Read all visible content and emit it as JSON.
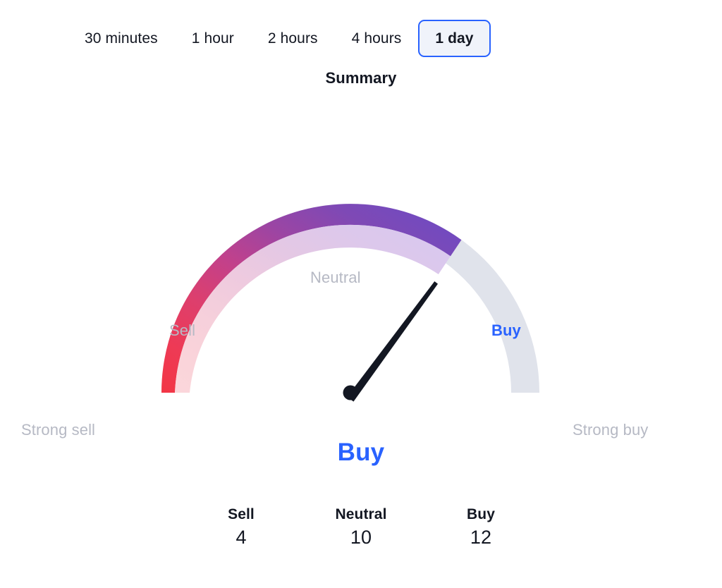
{
  "timeframes": {
    "options": [
      {
        "label": "30 minutes",
        "selected": false
      },
      {
        "label": "1 hour",
        "selected": false
      },
      {
        "label": "2 hours",
        "selected": false
      },
      {
        "label": "4 hours",
        "selected": false
      },
      {
        "label": "1 day",
        "selected": true
      }
    ],
    "selected_label": "1 day"
  },
  "summary": {
    "title": "Summary",
    "verdict": "Buy"
  },
  "gauge": {
    "zone_labels": {
      "strong_sell": "Strong sell",
      "sell": "Sell",
      "neutral": "Neutral",
      "buy": "Buy",
      "strong_buy": "Strong buy"
    },
    "active_zone": "buy"
  },
  "counts": {
    "items": [
      {
        "label": "Sell",
        "value": "4"
      },
      {
        "label": "Neutral",
        "value": "10"
      },
      {
        "label": "Buy",
        "value": "12"
      }
    ]
  },
  "colors": {
    "accent_blue": "#2962ff",
    "text_dark": "#131722",
    "text_muted": "#b6b9c4",
    "tab_selected_bg": "#f0f3fa",
    "arc_track_gray": "#e0e3eb",
    "arc_red": "#f0384f",
    "arc_crimson": "#d8406f",
    "arc_magenta": "#b8408f",
    "arc_purple_mid": "#8d46a7",
    "arc_purple": "#6b4bc4",
    "needle": "#131722"
  },
  "chart_data": {
    "type": "gauge",
    "title": "Summary",
    "zones": [
      {
        "name": "Strong sell",
        "start_deg": -90,
        "end_deg": -54
      },
      {
        "name": "Sell",
        "start_deg": -54,
        "end_deg": -18
      },
      {
        "name": "Neutral",
        "start_deg": -18,
        "end_deg": 18
      },
      {
        "name": "Buy",
        "start_deg": 18,
        "end_deg": 54
      },
      {
        "name": "Strong buy",
        "start_deg": 54,
        "end_deg": 90
      }
    ],
    "needle_zone": "Buy",
    "needle_angle_deg": 37,
    "range_deg": [
      -90,
      90
    ],
    "filled_to_deg": 36,
    "legend": [
      "Strong sell",
      "Sell",
      "Neutral",
      "Buy",
      "Strong buy"
    ],
    "counts": {
      "Sell": 4,
      "Neutral": 10,
      "Buy": 12
    }
  }
}
